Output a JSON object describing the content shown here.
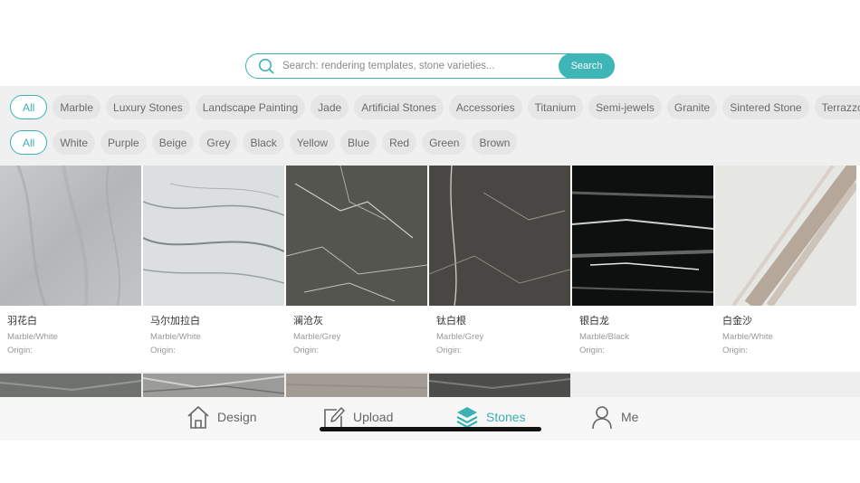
{
  "search": {
    "placeholder": "Search: rendering templates, stone varieties...",
    "button_label": "Search",
    "icon": "search-icon"
  },
  "filters": {
    "categories": [
      "All",
      "Marble",
      "Luxury Stones",
      "Landscape Painting",
      "Jade",
      "Artificial Stones",
      "Accessories",
      "Titanium",
      "Semi-jewels",
      "Granite",
      "Sintered Stone",
      "Terrazzo"
    ],
    "colors": [
      "All",
      "White",
      "Purple",
      "Beige",
      "Grey",
      "Black",
      "Yellow",
      "Blue",
      "Red",
      "Green",
      "Brown"
    ],
    "selected_category": "All",
    "selected_color": "All"
  },
  "stones": [
    {
      "name": "羽花白",
      "category": "Marble/White",
      "origin": "Origin:"
    },
    {
      "name": "马尔加拉白",
      "category": "Marble/White",
      "origin": "Origin:"
    },
    {
      "name": "澜沧灰",
      "category": "Marble/Grey",
      "origin": "Origin:"
    },
    {
      "name": "钛白根",
      "category": "Marble/Grey",
      "origin": "Origin:"
    },
    {
      "name": "银白龙",
      "category": "Marble/Black",
      "origin": "Origin:"
    },
    {
      "name": "白金沙",
      "category": "Marble/White",
      "origin": "Origin:"
    }
  ],
  "tabbar": {
    "tabs": [
      {
        "label": "Design",
        "icon": "home-icon"
      },
      {
        "label": "Upload",
        "icon": "edit-icon"
      },
      {
        "label": "Stones",
        "icon": "layers-icon"
      },
      {
        "label": "Me",
        "icon": "user-icon"
      }
    ],
    "active": "Stones"
  },
  "colors": {
    "accent": "#3bb1b3",
    "filter_bg": "#f0f0f0",
    "chip_bg": "#e6e6e6"
  }
}
